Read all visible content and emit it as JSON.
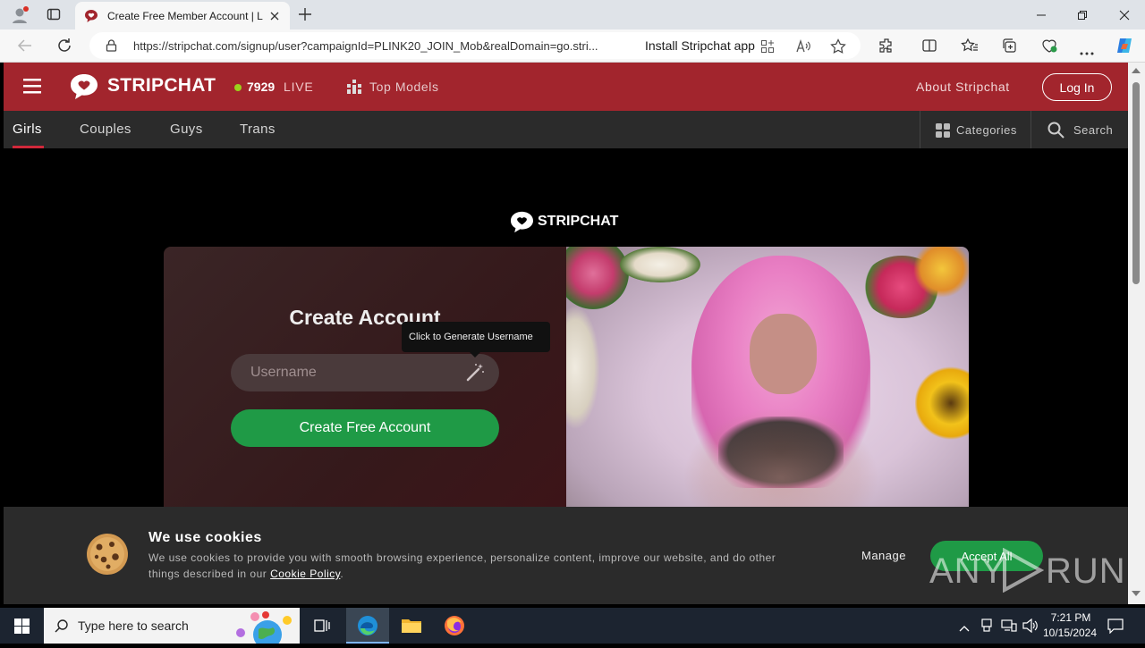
{
  "browser": {
    "tab_title": "Create Free Member Account | Li",
    "url": "https://stripchat.com/signup/user?campaignId=PLINK20_JOIN_Mob&realDomain=go.stri...",
    "install_app": "Install Stripchat app"
  },
  "header": {
    "logo_text": "STRIPCHAT",
    "live_count": "7929",
    "live_label": "LIVE",
    "top_models": "Top Models",
    "about": "About Stripchat",
    "login": "Log In"
  },
  "nav": {
    "tabs": [
      "Girls",
      "Couples",
      "Guys",
      "Trans"
    ],
    "categories": "Categories",
    "search": "Search"
  },
  "signup": {
    "logo_text": "STRIPCHAT",
    "title": "Create Account",
    "tooltip": "Click to Generate Username",
    "username_placeholder": "Username",
    "submit": "Create Free Account"
  },
  "cookie": {
    "title": "We use cookies",
    "body_line1": "We use cookies to provide you with smooth browsing experience, personalize content, improve our website, and do other",
    "body_line2": "things described in our",
    "policy_link": "Cookie Policy",
    "manage": "Manage",
    "accept": "Accept All"
  },
  "watermark": {
    "text_left": "ANY",
    "text_right": "RUN"
  },
  "taskbar": {
    "search_placeholder": "Type here to search",
    "time": "7:21 PM",
    "date": "10/15/2024"
  },
  "colors": {
    "brand_red": "#a2252d",
    "green": "#1f9a46",
    "live_dot": "#9bd21c"
  }
}
